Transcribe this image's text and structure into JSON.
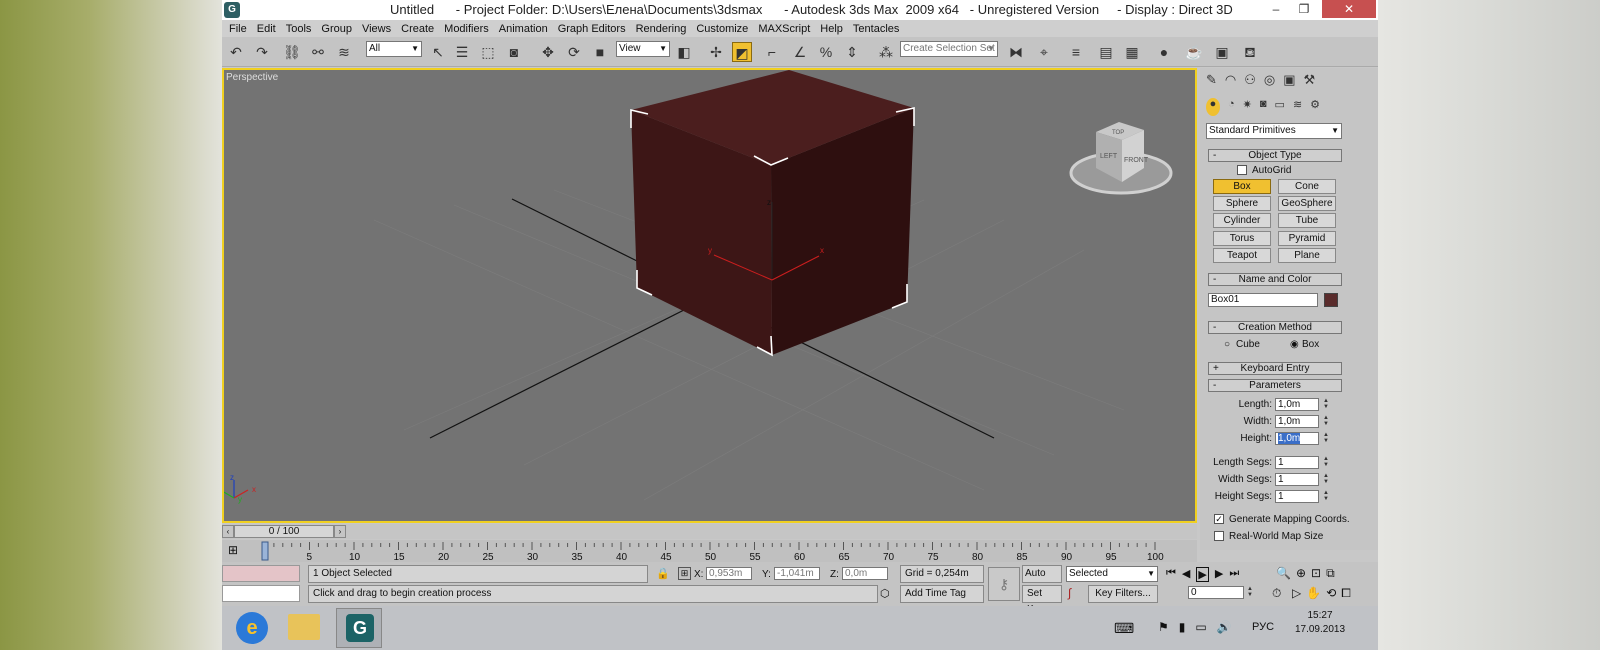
{
  "window": {
    "title": "Untitled      - Project Folder: D:\\Users\\Елена\\Documents\\3dsmax      - Autodesk 3ds Max  2009 x64   - Unregistered Version     - Display : Direct 3D",
    "app_icon": "G",
    "min_glyph": "–",
    "max_glyph": "❐",
    "close_glyph": "✕"
  },
  "menu": [
    "File",
    "Edit",
    "Tools",
    "Group",
    "Views",
    "Create",
    "Modifiers",
    "Animation",
    "Graph Editors",
    "Rendering",
    "Customize",
    "MAXScript",
    "Help",
    "Tentacles"
  ],
  "toolbar": {
    "selection_filter": "All",
    "coordinate_system": "View",
    "named_selection_placeholder": "Create Selection Set",
    "icons": [
      "undo-icon",
      "redo-icon",
      "select-link-icon",
      "unlink-icon",
      "bind-space-warp-icon",
      "select-icon",
      "select-by-name-icon",
      "rect-selection-icon",
      "window-crossing-icon",
      "move-icon",
      "rotate-icon",
      "scale-icon",
      "pivot-icon",
      "manipulate-icon",
      "keyboard-shortcut-icon",
      "snap-icon",
      "angle-snap-icon",
      "percent-snap-icon",
      "spinner-snap-icon",
      "edit-named-sets-icon",
      "mirror-icon",
      "align-icon",
      "layer-manager-icon",
      "curve-editor-icon",
      "schematic-view-icon",
      "material-editor-icon",
      "render-setup-icon",
      "rendered-frame-icon",
      "quick-render-icon"
    ]
  },
  "viewport": {
    "label": "Perspective",
    "viewcube": {
      "top": "TOP",
      "left": "LEFT",
      "front": "FRONT"
    },
    "gizmo": {
      "x": "x",
      "y": "y",
      "z": "z"
    },
    "object_color": "#3d1616"
  },
  "command_panel": {
    "category": "Standard Primitives",
    "object_type_title": "Object Type",
    "autogrid_label": "AutoGrid",
    "buttons": [
      "Box",
      "Cone",
      "Sphere",
      "GeoSphere",
      "Cylinder",
      "Tube",
      "Torus",
      "Pyramid",
      "Teapot",
      "Plane"
    ],
    "active_button": "Box",
    "name_color_title": "Name and Color",
    "object_name": "Box01",
    "swatch_color": "#5a2c2c",
    "creation_method_title": "Creation Method",
    "creation_options": [
      "Cube",
      "Box"
    ],
    "creation_selected": "Box",
    "keyboard_entry_title": "Keyboard Entry",
    "parameters_title": "Parameters",
    "params": [
      {
        "label": "Length:",
        "value": "1,0m"
      },
      {
        "label": "Width:",
        "value": "1,0m"
      },
      {
        "label": "Height:",
        "value": "1,0m"
      }
    ],
    "segs": [
      {
        "label": "Length Segs:",
        "value": "1"
      },
      {
        "label": "Width Segs:",
        "value": "1"
      },
      {
        "label": "Height Segs:",
        "value": "1"
      }
    ],
    "generate_mapping_label": "Generate Mapping Coords.",
    "generate_mapping_checked": true,
    "real_world_label": "Real-World Map Size",
    "real_world_checked": false
  },
  "timeline": {
    "slider_label": "0 / 100",
    "current_frame": 0,
    "total_frames": 100,
    "ticks": [
      "0",
      "5",
      "10",
      "15",
      "20",
      "25",
      "30",
      "35",
      "40",
      "45",
      "50",
      "55",
      "60",
      "65",
      "70",
      "75",
      "80",
      "85",
      "90",
      "95",
      "100"
    ]
  },
  "status": {
    "selection": "1 Object Selected",
    "prompt": "Click and drag to begin creation process",
    "x_label": "X:",
    "x_value": "0,953m",
    "y_label": "Y:",
    "y_value": "-1,041m",
    "z_label": "Z:",
    "z_value": "0,0m",
    "grid": "Grid = 0,254m",
    "add_time_tag": "Add Time Tag",
    "auto_key": "Auto Key",
    "set_key": "Set Key",
    "key_mode": "Selected",
    "key_filters": "Key Filters...",
    "frame_field": "0"
  },
  "taskbar": {
    "language": "РУС",
    "time": "15:27",
    "date": "17.09.2013"
  }
}
